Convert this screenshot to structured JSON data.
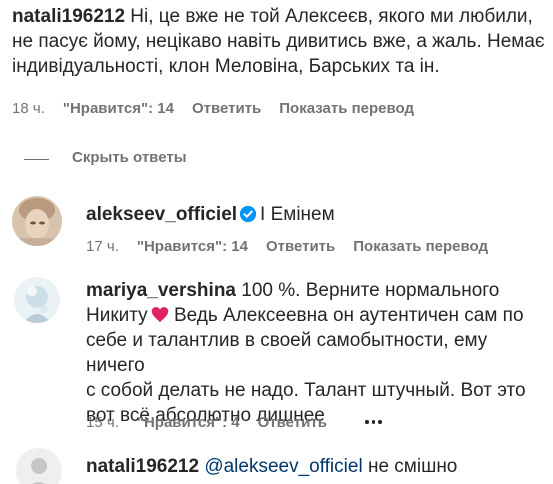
{
  "comments": [
    {
      "username": "natali196212",
      "text": " Ні, це вже не той Алексеєв, якого ми любили, ",
      "line2": "не пасує йому, нецікаво навіть дивитись вже, а жаль. Немає",
      "line3": "індивідуальності, клон Меловіна, Барських та ін.",
      "time": "18 ч.",
      "likes": "\"Нравится\": 14",
      "reply": "Ответить",
      "translate": "Показать перевод"
    }
  ],
  "hide_replies": "Скрыть ответы",
  "replies": [
    {
      "username": "alekseev_officiel",
      "verified": true,
      "text": "І Емінем",
      "time": "17 ч.",
      "likes": "\"Нравится\": 14",
      "reply": "Ответить",
      "translate": "Показать перевод"
    },
    {
      "username": "mariya_vershina",
      "line1": " 100 %. Верните нормального",
      "line2a": "Никиту",
      "line2b": " Ведь Алексеевна он аутентичен сам по",
      "line3": "себе и талантлив в своей самобытности, ему ничего",
      "line4": "с собой делать не надо. Талант штучный. Вот это",
      "line5": "вот всё абсолютно лишнее",
      "time": "15 ч.",
      "likes": "\"Нравится\": 4",
      "reply": "Ответить"
    },
    {
      "username": "natali196212",
      "mention": "@alekseev_officiel",
      "text": " не смішно"
    }
  ],
  "colors": {
    "text": "#262626",
    "secondary": "#737373",
    "mention": "#00376b",
    "verified": "#0095f6",
    "heart": "#e0245e"
  }
}
